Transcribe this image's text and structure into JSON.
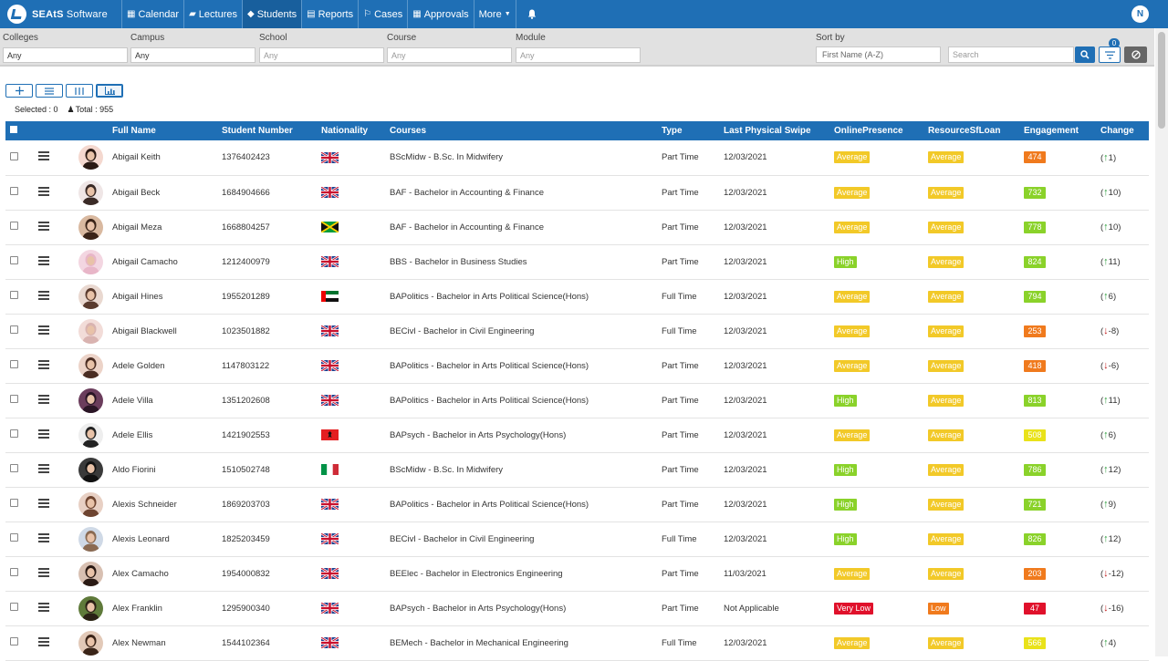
{
  "app": {
    "brand_bold": "SEAtS",
    "brand_rest": " Software",
    "user_initial": "N"
  },
  "nav": [
    {
      "label": "Calendar",
      "icon": "calendar-icon",
      "glyph": "▦",
      "active": false
    },
    {
      "label": "Lectures",
      "icon": "book-icon",
      "glyph": "▰",
      "active": false
    },
    {
      "label": "Students",
      "icon": "graduation-cap-icon",
      "glyph": "◆",
      "active": true
    },
    {
      "label": "Reports",
      "icon": "document-icon",
      "glyph": "▤",
      "active": false
    },
    {
      "label": "Cases",
      "icon": "gavel-icon",
      "glyph": "⚐",
      "active": false
    },
    {
      "label": "Approvals",
      "icon": "calendar-check-icon",
      "glyph": "▦",
      "active": false
    },
    {
      "label": "More",
      "icon": "caret-down-icon",
      "glyph": "",
      "active": false
    }
  ],
  "filters": {
    "colleges": {
      "label": "Colleges",
      "value": "Any"
    },
    "campus": {
      "label": "Campus",
      "value": "Any"
    },
    "school": {
      "label": "School",
      "placeholder": "Any"
    },
    "course": {
      "label": "Course",
      "placeholder": "Any"
    },
    "module": {
      "label": "Module",
      "placeholder": "Any"
    },
    "sort": {
      "label": "Sort by",
      "value": "First Name (A-Z)"
    },
    "search": {
      "placeholder": "Search"
    },
    "filter_count": "0"
  },
  "counts": {
    "selected": "Selected : 0",
    "total": "Total : 955"
  },
  "columns": {
    "full_name": "Full Name",
    "student_number": "Student Number",
    "nationality": "Nationality",
    "courses": "Courses",
    "type": "Type",
    "last_swipe": "Last Physical Swipe",
    "online": "OnlinePresence",
    "resource": "ResourceSfLoan",
    "engagement": "Engagement",
    "change": "Change"
  },
  "colors": {
    "primary": "#1f6fb5",
    "average": "#f2c928",
    "high": "#8ad22a",
    "very_low": "#e0112b",
    "low": "#f07a1d",
    "eng_green": "#8ad22a",
    "eng_yellow": "#e9e21a",
    "eng_orange": "#f07a1d",
    "eng_red": "#e0112b"
  },
  "students": [
    {
      "name": "Abigail Keith",
      "number": "1376402423",
      "flag": "uk",
      "course": "BScMidw - B.Sc. In Midwifery",
      "type": "Part Time",
      "swipe": "12/03/2021",
      "online": "Average",
      "resource": "Average",
      "engagement": "474",
      "eng_color": "orange",
      "dir": "up",
      "change": "1"
    },
    {
      "name": "Abigail Beck",
      "number": "1684904666",
      "flag": "uk",
      "course": "BAF - Bachelor in Accounting & Finance",
      "type": "Part Time",
      "swipe": "12/03/2021",
      "online": "Average",
      "resource": "Average",
      "engagement": "732",
      "eng_color": "green",
      "dir": "up",
      "change": "10"
    },
    {
      "name": "Abigail Meza",
      "number": "1668804257",
      "flag": "jamaica",
      "course": "BAF - Bachelor in Accounting & Finance",
      "type": "Part Time",
      "swipe": "12/03/2021",
      "online": "Average",
      "resource": "Average",
      "engagement": "778",
      "eng_color": "green",
      "dir": "up",
      "change": "10"
    },
    {
      "name": "Abigail Camacho",
      "number": "1212400979",
      "flag": "uk",
      "course": "BBS - Bachelor in Business Studies",
      "type": "Part Time",
      "swipe": "12/03/2021",
      "online": "High",
      "resource": "Average",
      "engagement": "824",
      "eng_color": "green",
      "dir": "up",
      "change": "11"
    },
    {
      "name": "Abigail Hines",
      "number": "1955201289",
      "flag": "uae",
      "course": "BAPolitics - Bachelor in Arts Political Science(Hons)",
      "type": "Full Time",
      "swipe": "12/03/2021",
      "online": "Average",
      "resource": "Average",
      "engagement": "794",
      "eng_color": "green",
      "dir": "up",
      "change": "6"
    },
    {
      "name": "Abigail Blackwell",
      "number": "1023501882",
      "flag": "uk",
      "course": "BECivl - Bachelor in Civil Engineering",
      "type": "Full Time",
      "swipe": "12/03/2021",
      "online": "Average",
      "resource": "Average",
      "engagement": "253",
      "eng_color": "orange",
      "dir": "down",
      "change": "-8"
    },
    {
      "name": "Adele Golden",
      "number": "1147803122",
      "flag": "uk",
      "course": "BAPolitics - Bachelor in Arts Political Science(Hons)",
      "type": "Part Time",
      "swipe": "12/03/2021",
      "online": "Average",
      "resource": "Average",
      "engagement": "418",
      "eng_color": "orange",
      "dir": "down",
      "change": "-6"
    },
    {
      "name": "Adele Villa",
      "number": "1351202608",
      "flag": "uk",
      "course": "BAPolitics - Bachelor in Arts Political Science(Hons)",
      "type": "Part Time",
      "swipe": "12/03/2021",
      "online": "High",
      "resource": "Average",
      "engagement": "813",
      "eng_color": "green",
      "dir": "up",
      "change": "11"
    },
    {
      "name": "Adele Ellis",
      "number": "1421902553",
      "flag": "albania",
      "course": "BAPsych - Bachelor in Arts Psychology(Hons)",
      "type": "Part Time",
      "swipe": "12/03/2021",
      "online": "Average",
      "resource": "Average",
      "engagement": "508",
      "eng_color": "yellow",
      "dir": "up",
      "change": "6"
    },
    {
      "name": "Aldo Fiorini",
      "number": "1510502748",
      "flag": "italy",
      "course": "BScMidw - B.Sc. In Midwifery",
      "type": "Part Time",
      "swipe": "12/03/2021",
      "online": "High",
      "resource": "Average",
      "engagement": "786",
      "eng_color": "green",
      "dir": "up",
      "change": "12"
    },
    {
      "name": "Alexis Schneider",
      "number": "1869203703",
      "flag": "uk",
      "course": "BAPolitics - Bachelor in Arts Political Science(Hons)",
      "type": "Part Time",
      "swipe": "12/03/2021",
      "online": "High",
      "resource": "Average",
      "engagement": "721",
      "eng_color": "green",
      "dir": "up",
      "change": "9"
    },
    {
      "name": "Alexis Leonard",
      "number": "1825203459",
      "flag": "uk",
      "course": "BECivl - Bachelor in Civil Engineering",
      "type": "Full Time",
      "swipe": "12/03/2021",
      "online": "High",
      "resource": "Average",
      "engagement": "826",
      "eng_color": "green",
      "dir": "up",
      "change": "12"
    },
    {
      "name": "Alex Camacho",
      "number": "1954000832",
      "flag": "uk",
      "course": "BEElec - Bachelor in Electronics Engineering",
      "type": "Part Time",
      "swipe": "11/03/2021",
      "online": "Average",
      "resource": "Average",
      "engagement": "203",
      "eng_color": "orange",
      "dir": "down",
      "change": "-12"
    },
    {
      "name": "Alex Franklin",
      "number": "1295900340",
      "flag": "uk",
      "course": "BAPsych - Bachelor in Arts Psychology(Hons)",
      "type": "Part Time",
      "swipe": "Not Applicable",
      "online": "Very Low",
      "resource": "Low",
      "engagement": "47",
      "eng_color": "red",
      "dir": "down",
      "change": "-16"
    },
    {
      "name": "Alex Newman",
      "number": "1544102364",
      "flag": "uk",
      "course": "BEMech - Bachelor in Mechanical Engineering",
      "type": "Full Time",
      "swipe": "12/03/2021",
      "online": "Average",
      "resource": "Average",
      "engagement": "566",
      "eng_color": "yellow",
      "dir": "up",
      "change": "4"
    }
  ]
}
